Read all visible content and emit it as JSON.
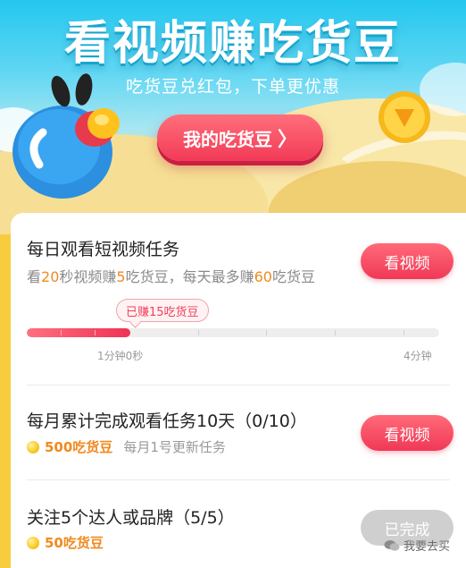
{
  "hero": {
    "title": "看视频赚吃货豆",
    "subtitle": "吃货豆兑红包，下单更优惠",
    "my_beans_label": "我的吃货豆",
    "my_beans_chevron": "〉"
  },
  "tasks": {
    "daily": {
      "title": "每日观看短视频任务",
      "desc_1": "看",
      "desc_2": "20",
      "desc_3": "秒视频赚",
      "desc_4": "5",
      "desc_5": "吃货豆，每天最多赚",
      "desc_6": "60",
      "desc_7": "吃货豆",
      "button": "看视频",
      "earned_bubble": "已赚15吃货豆",
      "progress_fraction": 0.25,
      "progress_mid_label": "1分钟0秒",
      "progress_end_label": "4分钟"
    },
    "monthly": {
      "title": "每月累计完成观看任务10天（0/10）",
      "reward": "500吃货豆",
      "note": "每月1号更新任务",
      "button": "看视频"
    },
    "follow": {
      "title": "关注5个达人或品牌（5/5）",
      "reward": "50吃货豆",
      "button": "已完成"
    }
  },
  "watermark": "我要去买",
  "colors": {
    "accent": "#f03857",
    "highlight": "#f08a20",
    "sky": "#24c7ef",
    "done": "#cfcfcf"
  }
}
